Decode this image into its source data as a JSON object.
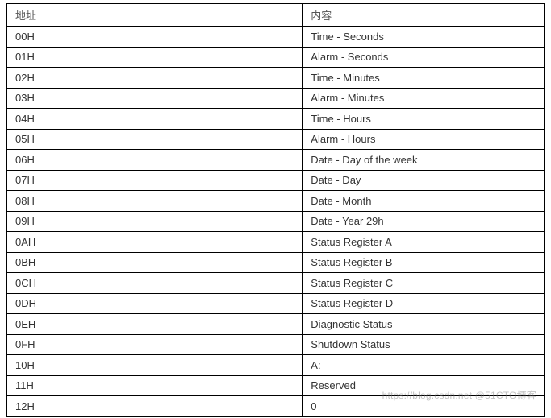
{
  "table": {
    "headers": [
      "地址",
      "内容"
    ],
    "rows": [
      {
        "addr": "00H",
        "desc": "Time - Seconds"
      },
      {
        "addr": "01H",
        "desc": "Alarm - Seconds"
      },
      {
        "addr": "02H",
        "desc": "Time - Minutes"
      },
      {
        "addr": "03H",
        "desc": "Alarm - Minutes"
      },
      {
        "addr": "04H",
        "desc": "Time - Hours"
      },
      {
        "addr": "05H",
        "desc": "Alarm - Hours"
      },
      {
        "addr": "06H",
        "desc": "Date - Day of the week"
      },
      {
        "addr": "07H",
        "desc": "Date - Day"
      },
      {
        "addr": "08H",
        "desc": "Date - Month"
      },
      {
        "addr": "09H",
        "desc": "Date - Year 29h"
      },
      {
        "addr": "0AH",
        "desc": "Status Register A"
      },
      {
        "addr": "0BH",
        "desc": "Status Register B"
      },
      {
        "addr": "0CH",
        "desc": "Status Register C"
      },
      {
        "addr": "0DH",
        "desc": "Status Register D"
      },
      {
        "addr": "0EH",
        "desc": "Diagnostic Status"
      },
      {
        "addr": "0FH",
        "desc": "Shutdown Status"
      },
      {
        "addr": "10H",
        "desc": "A:"
      },
      {
        "addr": "11H",
        "desc": "Reserved"
      },
      {
        "addr": "12H",
        "desc": "0"
      }
    ]
  },
  "watermark": "https://blog.csdn.net   @51CTO博客"
}
